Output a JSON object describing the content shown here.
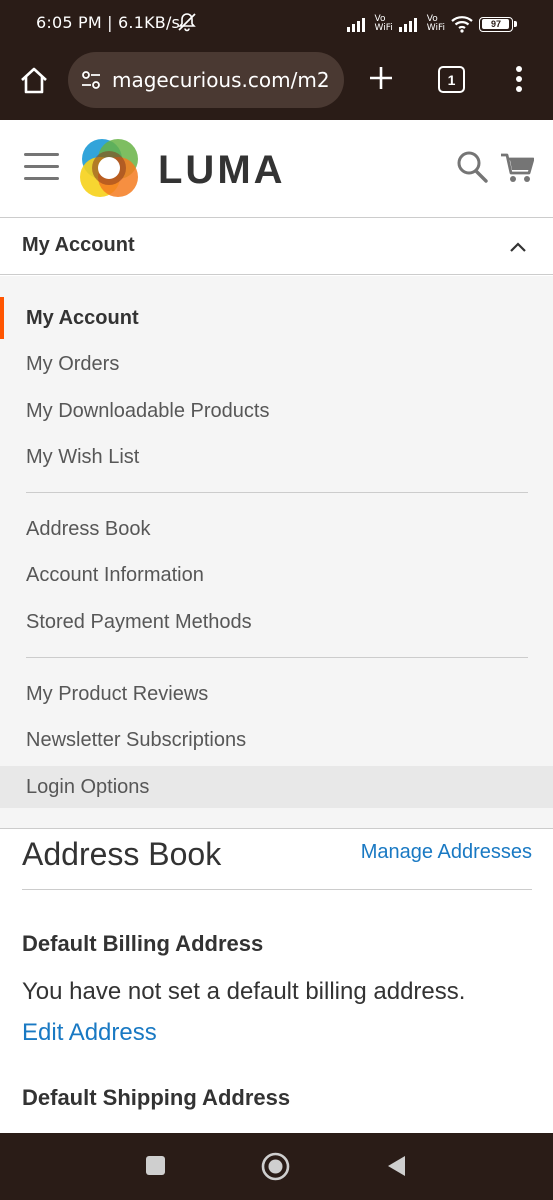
{
  "status_bar": {
    "time": "6:05 PM | 6.1KB/s",
    "vowifi_1": [
      "Vo",
      "WiFi"
    ],
    "vowifi_2": [
      "Vo",
      "WiFi"
    ],
    "battery": "97",
    "icons": [
      "mute-bell-icon",
      "signal-icon",
      "signal-icon",
      "wifi-icon",
      "battery-icon"
    ]
  },
  "browser": {
    "url": "magecurious.com/m2",
    "tab_count": "1",
    "icons": [
      "home-icon",
      "tune-icon",
      "plus-icon",
      "tabs-icon",
      "more-vert-icon"
    ]
  },
  "header": {
    "logo_text": "LUMA",
    "icons": [
      "hamburger-icon",
      "luma-logo",
      "search-icon",
      "cart-icon"
    ]
  },
  "account_nav": {
    "toggle_label": "My Account",
    "groups": [
      [
        "My Account",
        "My Orders",
        "My Downloadable Products",
        "My Wish List"
      ],
      [
        "Address Book",
        "Account Information",
        "Stored Payment Methods"
      ],
      [
        "My Product Reviews",
        "Newsletter Subscriptions",
        "Login Options"
      ]
    ],
    "current": "My Account",
    "accent_color": "#ff5501"
  },
  "address_book": {
    "title": "Address Book",
    "manage_link": "Manage Addresses",
    "billing_title": "Default Billing Address",
    "billing_text": "You have not set a default billing address.",
    "edit_link": "Edit Address",
    "shipping_title": "Default Shipping Address",
    "link_color": "#1979c3"
  },
  "android_nav": {
    "icons": [
      "recent-apps-icon",
      "home-circle-icon",
      "back-triangle-icon"
    ]
  }
}
